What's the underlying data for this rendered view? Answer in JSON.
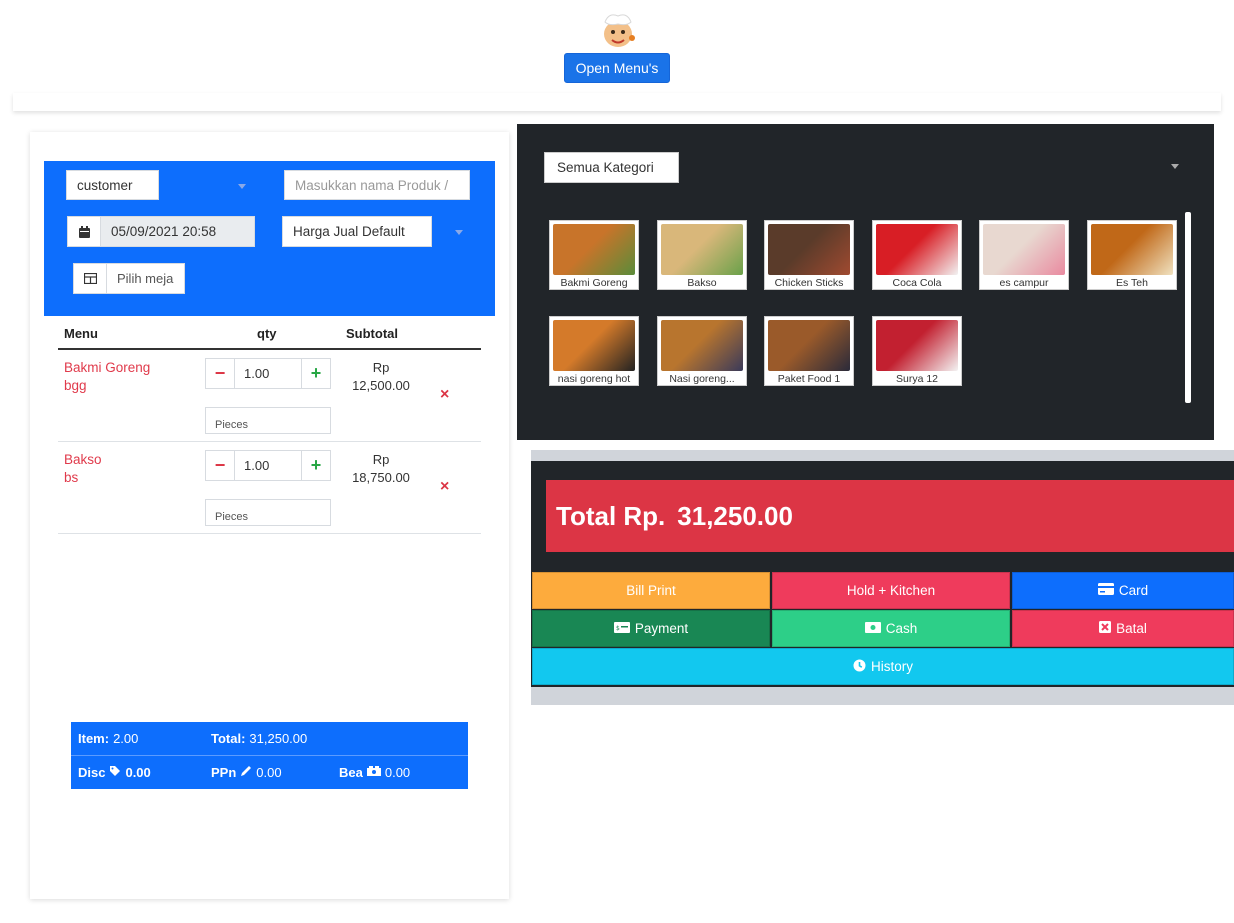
{
  "header": {
    "logo_icon": "chef-logo-icon",
    "open_menu_label": "Open Menu's"
  },
  "order_form": {
    "customer_value": "customer",
    "product_search_placeholder": "Masukkan nama Produk /",
    "datetime_value": "05/09/2021 20:58",
    "price_type_value": "Harga Jual Default",
    "table_placeholder": "Pilih meja"
  },
  "order_table": {
    "headers": {
      "menu": "Menu",
      "qty": "qty",
      "subtotal": "Subtotal"
    },
    "rows": [
      {
        "name": "Bakmi Goreng",
        "note": "bgg",
        "qty": "1.00",
        "unit_placeholder": "Pieces",
        "currency": "Rp",
        "subtotal": "12,500.00",
        "remove_icon": "×"
      },
      {
        "name": "Bakso",
        "note": "bs",
        "qty": "1.00",
        "unit_placeholder": "Pieces",
        "currency": "Rp",
        "subtotal": "18,750.00",
        "remove_icon": "×"
      }
    ],
    "minus_symbol": "−",
    "plus_symbol": "+"
  },
  "summary": {
    "item_label": "Item:",
    "item_value": "2.00",
    "total_label": "Total:",
    "total_value": "31,250.00",
    "disc_label": "Disc",
    "disc_value": "0.00",
    "ppn_label": "PPn",
    "ppn_value": "0.00",
    "bea_label": "Bea",
    "bea_value": "0.00"
  },
  "products": {
    "category_value": "Semua Kategori",
    "items": [
      {
        "name": "Bakmi Goreng",
        "color_a": "#c8742a",
        "color_b": "#5a8c3a"
      },
      {
        "name": "Bakso",
        "color_a": "#d9b77a",
        "color_b": "#6aa14a"
      },
      {
        "name": "Chicken Sticks",
        "color_a": "#5a3b2a",
        "color_b": "#a04a30"
      },
      {
        "name": "Coca Cola",
        "color_a": "#d81e25",
        "color_b": "#f2f2f2"
      },
      {
        "name": "es campur",
        "color_a": "#e8d8d0",
        "color_b": "#e98aa0"
      },
      {
        "name": "Es Teh",
        "color_a": "#c06818",
        "color_b": "#f0e2c0"
      },
      {
        "name": "nasi goreng hot",
        "color_a": "#d47a2a",
        "color_b": "#222222"
      },
      {
        "name": "Nasi goreng...",
        "color_a": "#b8752e",
        "color_b": "#3a3a5a"
      },
      {
        "name": "Paket Food 1",
        "color_a": "#9a5a2a",
        "color_b": "#2a2a3a"
      },
      {
        "name": "Surya 12",
        "color_a": "#c22030",
        "color_b": "#f3f3f3"
      }
    ]
  },
  "payment": {
    "total_label": "Total Rp.",
    "total_value": "31,250.00",
    "buttons": {
      "bill_print": "Bill Print",
      "hold_kitchen": "Hold + Kitchen",
      "card": "Card",
      "payment": "Payment",
      "cash": "Cash",
      "batal": "Batal",
      "history": "History"
    }
  },
  "colors": {
    "primary": "#0d6efd",
    "danger": "#dc3545",
    "warning": "#fdab3d",
    "pink": "#ef3b5c",
    "green_dark": "#198754",
    "green": "#2dcf88",
    "cyan": "#12c8ef",
    "dark": "#212529"
  }
}
